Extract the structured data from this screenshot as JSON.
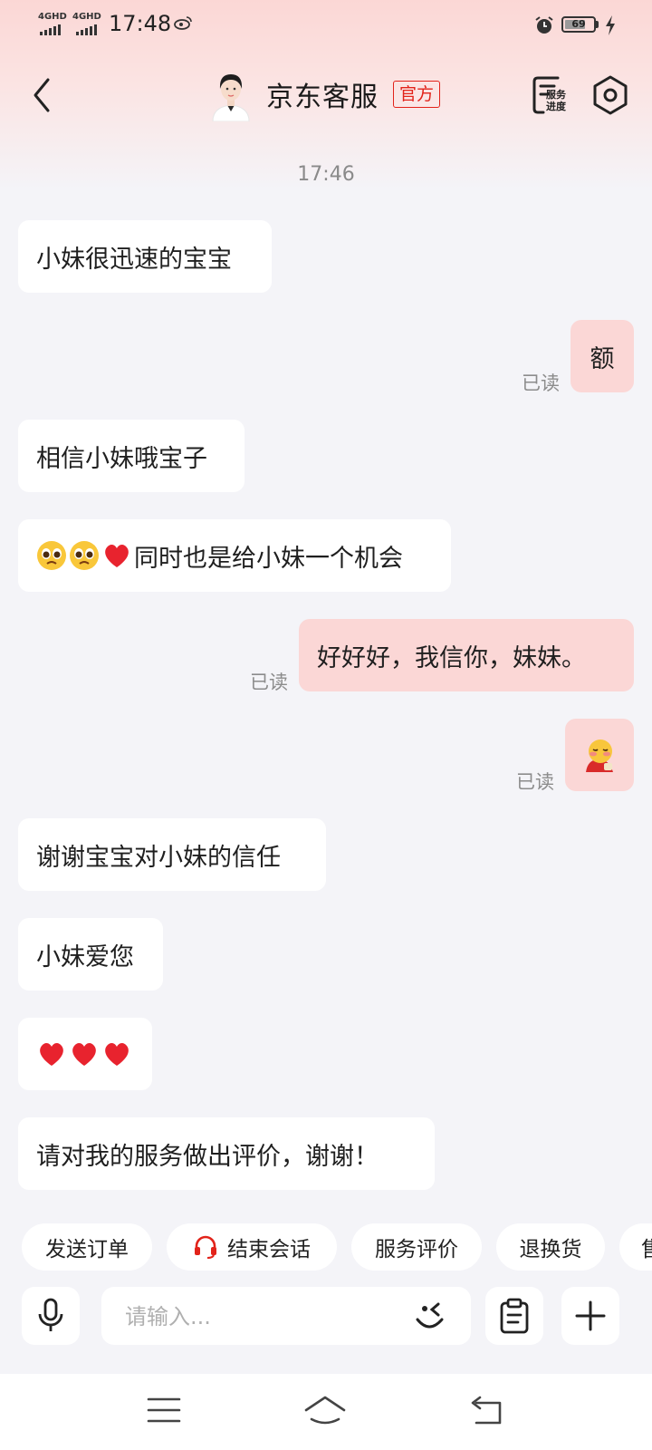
{
  "status_bar": {
    "network_1": "4GHD",
    "network_2": "4GHD",
    "time": "17:48",
    "battery_level": "69",
    "icons": [
      "weibo-icon",
      "alarm-icon",
      "battery-icon",
      "charging-icon"
    ]
  },
  "header": {
    "title": "京东客服",
    "badge": "官方",
    "service_progress_label_1": "服务",
    "service_progress_label_2": "进度",
    "icons": [
      "back-icon",
      "avatar",
      "service-progress-icon",
      "settings-icon"
    ]
  },
  "chat": {
    "timestamp": "17:46",
    "read_label": "已读",
    "messages": [
      {
        "from": "agent",
        "text": "小妹很迅速的宝宝"
      },
      {
        "from": "me",
        "text": "额",
        "status": "已读"
      },
      {
        "from": "agent",
        "text": "相信小妹哦宝子"
      },
      {
        "from": "agent",
        "text": "同时也是给小妹一个机会",
        "emojis": [
          "pleading-face",
          "pleading-face",
          "red-heart"
        ]
      },
      {
        "from": "me",
        "text": "好好好，我信你，妹妹。",
        "status": "已读"
      },
      {
        "from": "me",
        "sticker": "blushing-sticker",
        "status": "已读"
      },
      {
        "from": "agent",
        "text": "谢谢宝宝对小妹的信任"
      },
      {
        "from": "agent",
        "text": "小妹爱您"
      },
      {
        "from": "agent",
        "emojis": [
          "red-heart",
          "red-heart",
          "red-heart"
        ]
      },
      {
        "from": "agent",
        "text": "请对我的服务做出评价，谢谢！"
      }
    ]
  },
  "quick_actions": [
    {
      "label": "发送订单"
    },
    {
      "label": "结束会话",
      "icon": "headset-icon"
    },
    {
      "label": "服务评价"
    },
    {
      "label": "退换货"
    },
    {
      "label": "售"
    }
  ],
  "input": {
    "placeholder": "请输入...",
    "icons": [
      "microphone-icon",
      "emoji-icon",
      "clipboard-icon",
      "plus-icon"
    ]
  },
  "system_nav": {
    "icons": [
      "menu-icon",
      "home-icon",
      "back-nav-icon"
    ]
  },
  "colors": {
    "accent_red": "#e2231a",
    "my_bubble": "#fbd7d6",
    "agent_bubble": "#ffffff",
    "background": "#f4f4f8"
  }
}
